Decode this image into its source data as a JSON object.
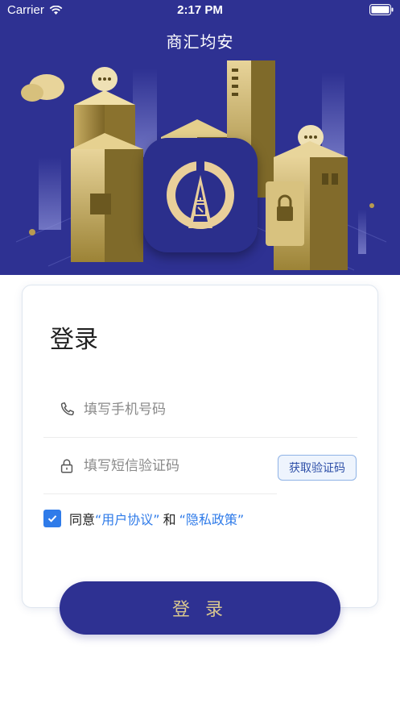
{
  "status_bar": {
    "carrier": "Carrier",
    "time": "2:17 PM",
    "wifi_icon": "wifi-icon",
    "battery_icon": "battery-icon"
  },
  "nav": {
    "title": "商汇均安"
  },
  "colors": {
    "brand": "#2e3192",
    "gold": "#d9c78f",
    "link": "#2f7be9",
    "checkbox": "#2f7be9"
  },
  "login": {
    "title": "登录",
    "phone_placeholder": "填写手机号码",
    "phone_icon": "phone-icon",
    "code_placeholder": "填写短信验证码",
    "code_icon": "lock-icon",
    "get_code_label": "获取验证码",
    "agree_checked": true,
    "agree_prefix": "同意",
    "agreement_link": "“用户协议”",
    "agree_and": "和",
    "privacy_link": "“隐私政策”",
    "submit_label": "登 录"
  }
}
